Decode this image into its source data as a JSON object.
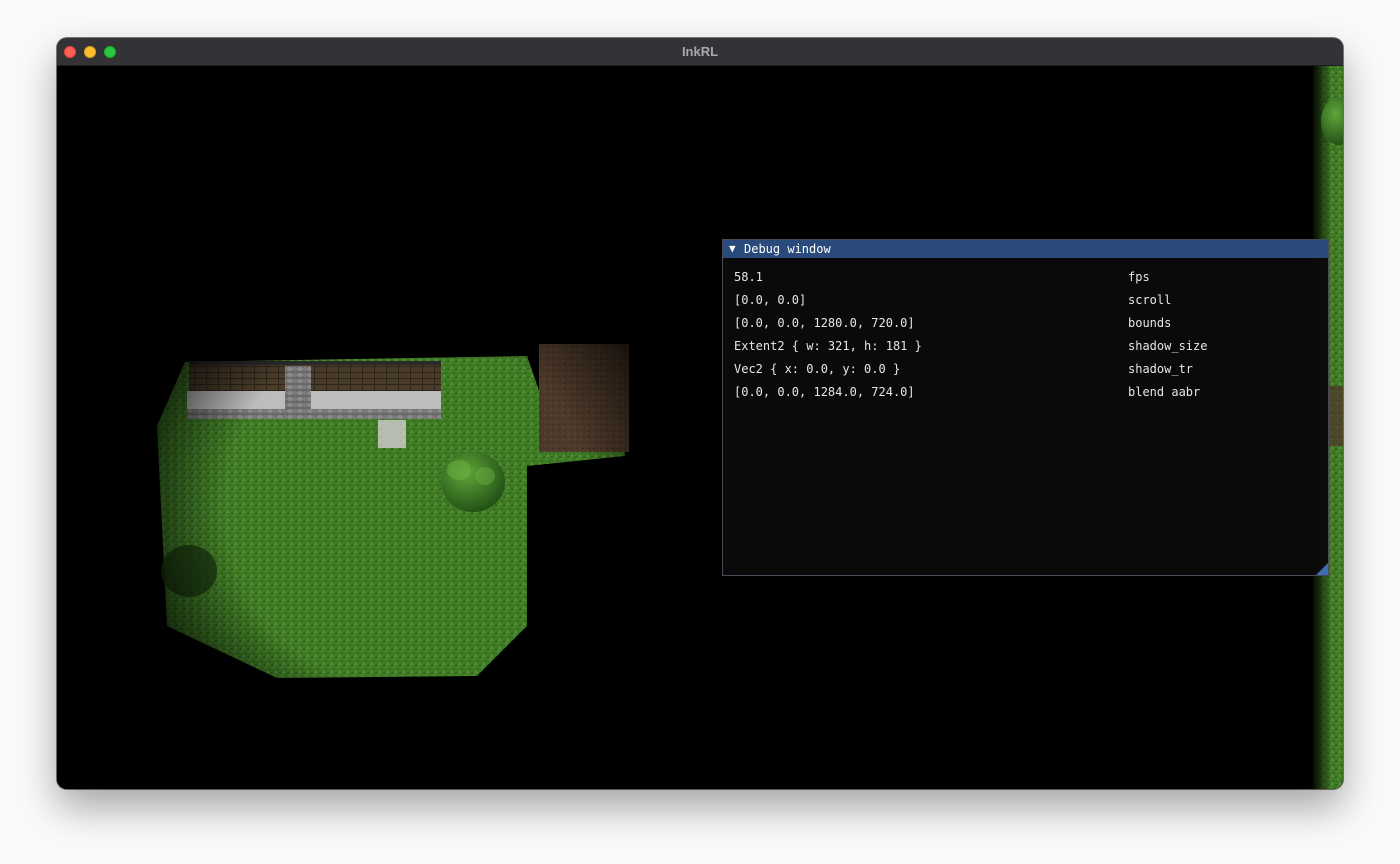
{
  "window": {
    "title": "InkRL"
  },
  "debug_window": {
    "title": "Debug window",
    "collapse_icon": "triangle-down-icon",
    "rows": [
      {
        "value": "58.1",
        "label": "fps"
      },
      {
        "value": "[0.0, 0.0]",
        "label": "scroll"
      },
      {
        "value": "[0.0, 0.0, 1280.0, 720.0]",
        "label": "bounds"
      },
      {
        "value": "Extent2 { w: 321, h: 181 }",
        "label": "shadow_size"
      },
      {
        "value": "Vec2 { x: 0.0, y: 0.0 }",
        "label": "shadow_tr"
      },
      {
        "value": "[0.0, 0.0, 1284.0, 724.0]",
        "label": "blend aabr"
      }
    ]
  },
  "colors": {
    "titlebar": "#333236",
    "debug_header": "#294a7a",
    "grass": "#3f7a25",
    "dirt": "#5a4330",
    "close": "#fe5f57",
    "minimize": "#febc2e",
    "maximize": "#28c840"
  }
}
